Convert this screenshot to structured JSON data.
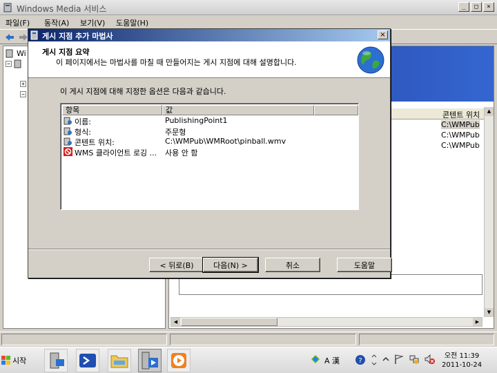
{
  "window": {
    "title": "Windows Media 서비스"
  },
  "menubar": [
    "파일(F)",
    "동작(A)",
    "보기(V)",
    "도움말(H)"
  ],
  "tree": {
    "root": "Wi"
  },
  "right_panel": {
    "col_header": "콘텐트 위치",
    "rows": [
      "C:\\WMPub",
      "C:\\WMPub",
      "C:\\WMPub"
    ]
  },
  "dialog": {
    "title": "게시 지점 추가 마법사",
    "header_title": "게시 지점 요약",
    "header_subtitle": "이 페이지에서는 마법사를 마칠 때 만들어지는 게시 지점에 대해 설명합니다.",
    "intro": "이 게시 지점에 대해 지정한 옵션은 다음과 같습니다.",
    "columns": [
      "항목",
      "값"
    ],
    "rows": [
      {
        "icon": "settings-icon",
        "name": "이름:",
        "value": "PublishingPoint1"
      },
      {
        "icon": "settings-icon",
        "name": "형식:",
        "value": "주문형"
      },
      {
        "icon": "settings-icon",
        "name": "콘텐트 위치:",
        "value": "C:\\WMPub\\WMRoot\\pinball.wmv"
      },
      {
        "icon": "disabled-logging-icon",
        "name": "WMS 클라이언트 로깅 ...",
        "value": "사용 안 함"
      }
    ],
    "buttons": {
      "back": "< 뒤로(B)",
      "next": "다음(N) >",
      "cancel": "취소",
      "help": "도움말"
    }
  },
  "taskbar": {
    "start": "시작",
    "tray_ime": "A 漢",
    "clock_period": "오전 11:39",
    "clock_date": "2011-10-24"
  }
}
